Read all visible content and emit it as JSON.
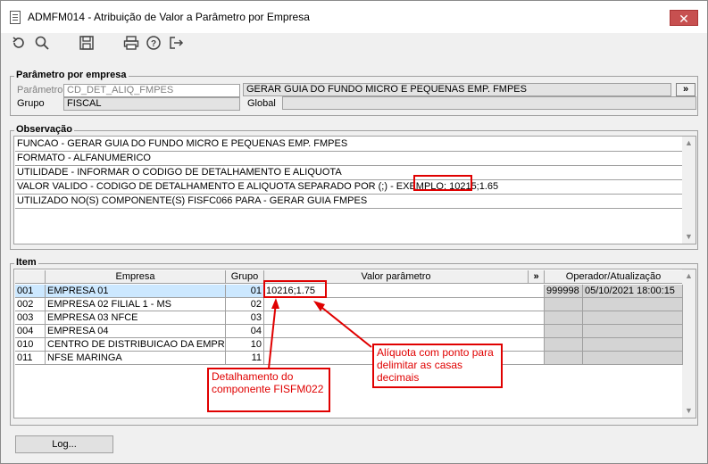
{
  "window": {
    "title": "ADMFM014 - Atribuição de Valor a Parâmetro por Empresa",
    "close_label": "✕"
  },
  "toolbar": {
    "icons": [
      "undo-icon",
      "search-icon",
      "save-icon",
      "print-icon",
      "help-icon",
      "exit-icon"
    ]
  },
  "parametro_group": {
    "title": "Parâmetro por empresa",
    "parametro_label": "Parâmetro",
    "parametro_value": "CD_DET_ALIQ_FMPES",
    "parametro_desc": "GERAR GUIA DO FUNDO MICRO E PEQUENAS EMP. FMPES",
    "more_button": "»",
    "grupo_label": "Grupo",
    "grupo_value": "FISCAL",
    "global_label": "Global",
    "global_value": ""
  },
  "observacao": {
    "title": "Observação",
    "lines": [
      "FUNCAO - GERAR GUIA DO FUNDO MICRO E PEQUENAS EMP. FMPES",
      "FORMATO - ALFANUMERICO",
      "UTILIDADE - INFORMAR O CODIGO DE DETALHAMENTO E ALIQUOTA",
      "VALOR VALIDO - CODIGO DE DETALHAMENTO E ALIQUOTA SEPARADO POR (;) - EXEMPLO: 10215;1.65",
      "UTILIZADO NO(S) COMPONENTE(S) FISFC066  PARA  - GERAR GUIA FMPES"
    ]
  },
  "item": {
    "title": "Item",
    "headers": {
      "empresa": "Empresa",
      "grupo": "Grupo",
      "valor": "Valor parâmetro",
      "more": "»",
      "operador": "Operador/Atualização"
    },
    "rows": [
      {
        "cod": "001",
        "empresa": "EMPRESA 01",
        "grupo": "01",
        "valor": "10216;1.75",
        "operador": "999998",
        "atualizacao": "05/10/2021 18:00:15"
      },
      {
        "cod": "002",
        "empresa": "EMPRESA 02 FILIAL 1 - MS",
        "grupo": "02",
        "valor": "",
        "operador": "",
        "atualizacao": ""
      },
      {
        "cod": "003",
        "empresa": "EMPRESA 03 NFCE",
        "grupo": "03",
        "valor": "",
        "operador": "",
        "atualizacao": ""
      },
      {
        "cod": "004",
        "empresa": "EMPRESA 04",
        "grupo": "04",
        "valor": "",
        "operador": "",
        "atualizacao": ""
      },
      {
        "cod": "010",
        "empresa": "CENTRO DE DISTRIBUICAO DA EMPRESA",
        "grupo": "10",
        "valor": "",
        "operador": "",
        "atualizacao": ""
      },
      {
        "cod": "011",
        "empresa": "NFSE MARINGA",
        "grupo": "11",
        "valor": "",
        "operador": "",
        "atualizacao": ""
      }
    ]
  },
  "annotations": {
    "aliquota_note": "Alíquota com ponto para delimitar as casas decimais",
    "detalhamento_note": "Detalhamento do componente FISFM022",
    "accent_color": "#e00000"
  },
  "footer": {
    "log_button": "Log..."
  }
}
